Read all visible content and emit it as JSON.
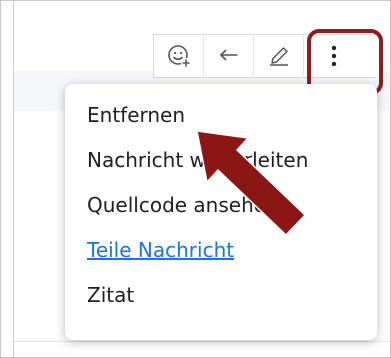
{
  "toolbar": {
    "buttons": [
      {
        "icon": "emoji-reaction-icon"
      },
      {
        "icon": "reply-icon"
      },
      {
        "icon": "edit-icon"
      },
      {
        "icon": "more-vertical-icon"
      }
    ]
  },
  "menu": {
    "items": [
      {
        "label": "Entfernen"
      },
      {
        "label": "Nachricht weiterleiten"
      },
      {
        "label": "Quellcode ansehen"
      },
      {
        "label": "Teile Nachricht"
      },
      {
        "label": "Zitat"
      }
    ]
  },
  "colors": {
    "accent_red": "#8a1f1f",
    "link_blue": "#1a73e8",
    "icon_gray": "#555555"
  }
}
